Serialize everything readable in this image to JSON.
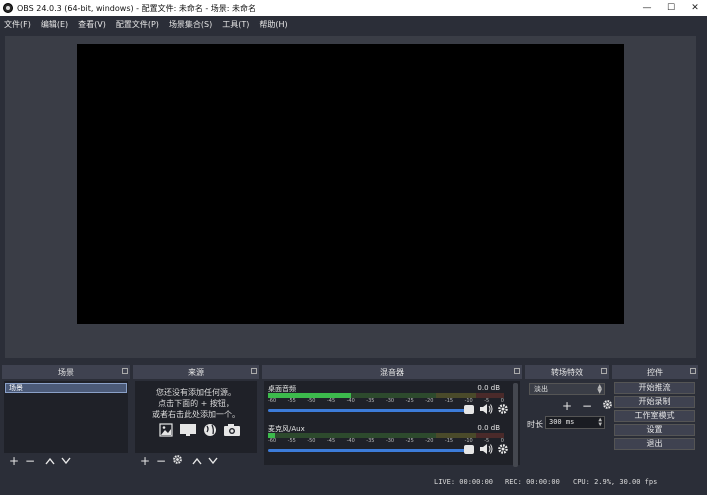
{
  "window": {
    "title": "OBS 24.0.3 (64-bit, windows) - 配置文件: 未命名 - 场景: 未命名",
    "minimize": "—",
    "maximize": "☐",
    "close": "✕"
  },
  "menu": {
    "items": [
      "文件(F)",
      "编辑(E)",
      "查看(V)",
      "配置文件(P)",
      "场景集合(S)",
      "工具(T)",
      "帮助(H)"
    ]
  },
  "docks": {
    "scenes": {
      "title": "场景",
      "selected": "场景"
    },
    "sources": {
      "title": "来源",
      "empty_lines": [
        "您还没有添加任何源。",
        "点击下面的 + 按钮，",
        "或者右击此处添加一个。"
      ]
    },
    "mixer": {
      "title": "混音器",
      "ticks": [
        "-60",
        "-55",
        "-50",
        "-45",
        "-40",
        "-35",
        "-30",
        "-25",
        "-20",
        "-15",
        "-10",
        "-5",
        "0"
      ],
      "channels": [
        {
          "name": "桌面音频",
          "db": "0.0 dB",
          "level": 0.35,
          "volume": 1.0
        },
        {
          "name": "麦克风/Aux",
          "db": "0.0 dB",
          "level": 0.03,
          "volume": 1.0
        }
      ]
    },
    "transitions": {
      "title": "转场特效",
      "selected": "淡出",
      "duration_label": "时长",
      "duration_value": "300 ms"
    },
    "controls": {
      "title": "控件",
      "buttons": [
        "开始推流",
        "开始录制",
        "工作室模式",
        "设置",
        "退出"
      ]
    }
  },
  "status": {
    "live": "LIVE: 00:00:00",
    "rec": "REC: 00:00:00",
    "cpu": "CPU: 2.9%, 30.00 fps"
  },
  "colors": {
    "accent": "#3c7bd8",
    "meter_green": "#3cba4c",
    "background": "#2b2e38"
  }
}
